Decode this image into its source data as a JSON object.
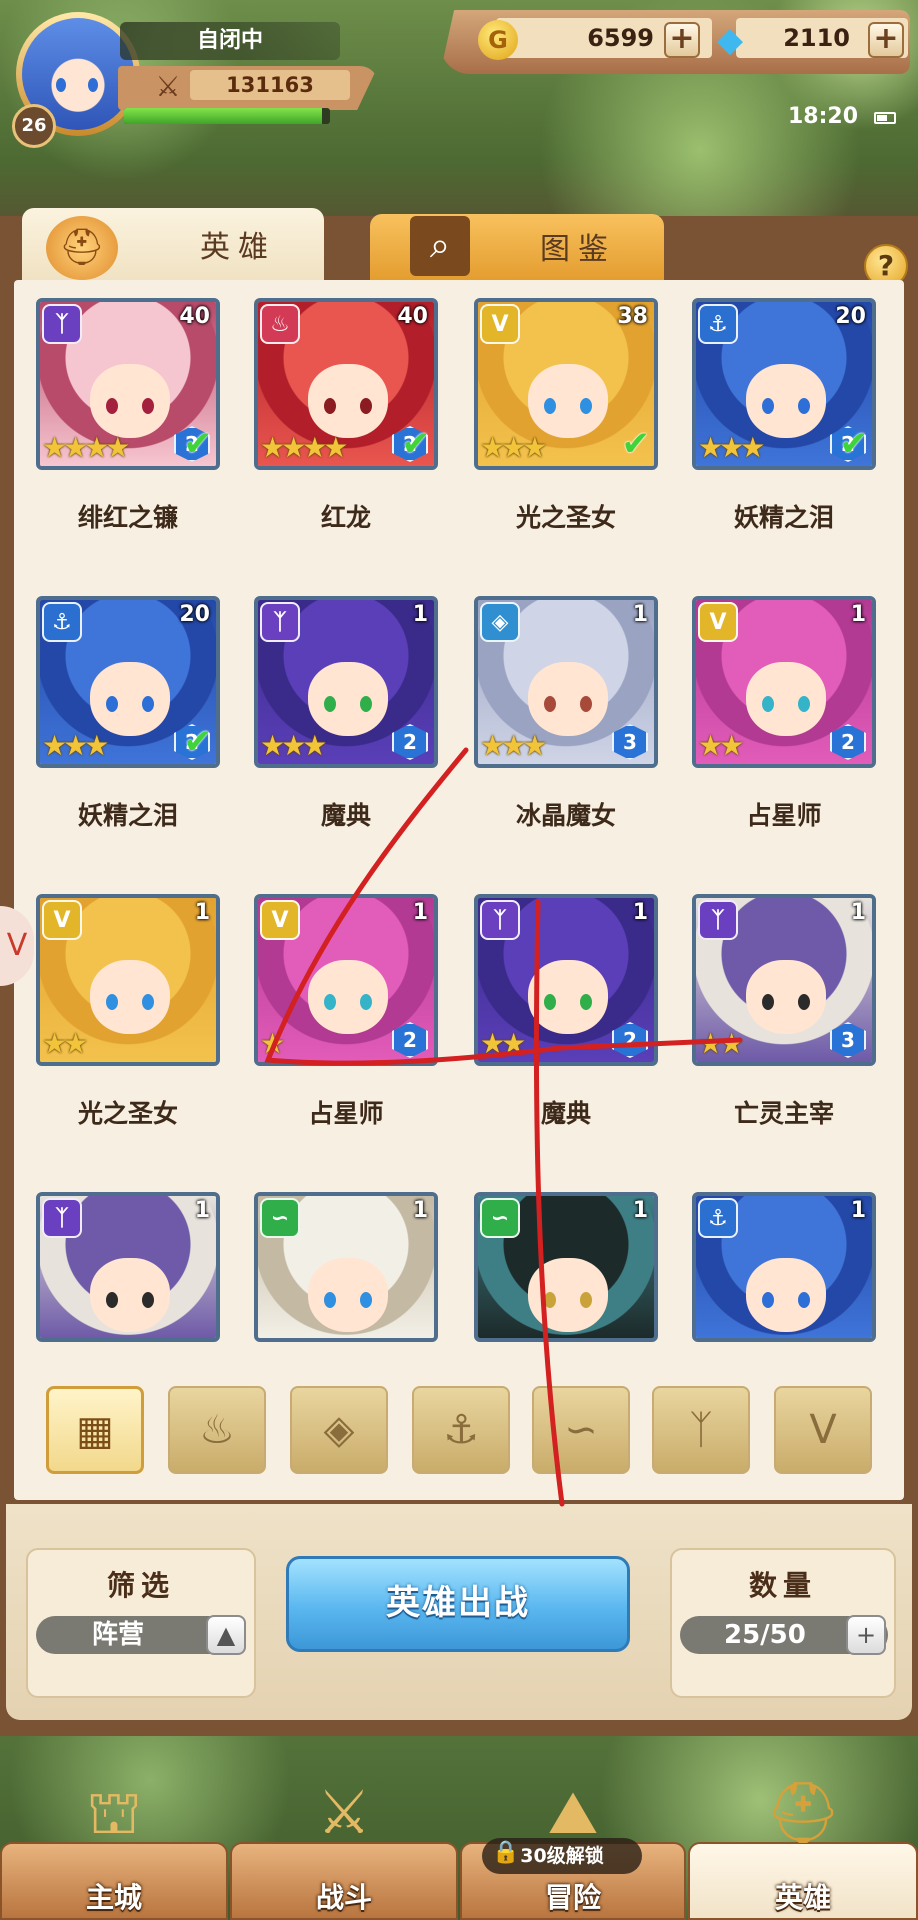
{
  "player": {
    "name": "自闭中",
    "level": "26",
    "power": "131163",
    "exp_fraction": 0.96
  },
  "resources": {
    "gold": "6599",
    "diamonds": "2110"
  },
  "status": {
    "time": "18:20"
  },
  "tabs": [
    {
      "label": "英雄",
      "icon": "helmet-icon",
      "active": true
    },
    {
      "label": "图鉴",
      "icon": "magnifier-icon",
      "active": false
    }
  ],
  "help_label": "?",
  "factions": {
    "shadow": {
      "glyph": "ᛉ",
      "color": "#6a3fc0"
    },
    "flame": {
      "glyph": "♨",
      "color": "#d23a55"
    },
    "light": {
      "glyph": "V",
      "color": "#e3b62a"
    },
    "ocean": {
      "glyph": "⚓",
      "color": "#2b6fd0"
    },
    "crystal": {
      "glyph": "◈",
      "color": "#2f8fd0"
    },
    "beast": {
      "glyph": "∽",
      "color": "#2fae4a"
    }
  },
  "heroes": [
    {
      "name": "绯红之镰",
      "faction": "shadow",
      "level": "40",
      "stars": "★★★★",
      "rank": "2",
      "checked": true
    },
    {
      "name": "红龙",
      "faction": "flame",
      "level": "40",
      "stars": "★★★★",
      "rank": "2",
      "checked": true
    },
    {
      "name": "光之圣女",
      "faction": "light",
      "level": "38",
      "stars": "★★★",
      "rank": "",
      "checked": true
    },
    {
      "name": "妖精之泪",
      "faction": "ocean",
      "level": "20",
      "stars": "★★★",
      "rank": "2",
      "checked": true
    },
    {
      "name": "妖精之泪",
      "faction": "ocean",
      "level": "20",
      "stars": "★★★",
      "rank": "2",
      "checked": true
    },
    {
      "name": "魔典",
      "faction": "shadow",
      "level": "1",
      "stars": "★★★",
      "rank": "2",
      "checked": false
    },
    {
      "name": "冰晶魔女",
      "faction": "crystal",
      "level": "1",
      "stars": "★★★",
      "rank": "3",
      "checked": false
    },
    {
      "name": "占星师",
      "faction": "light",
      "level": "1",
      "stars": "★★",
      "rank": "2",
      "checked": false
    },
    {
      "name": "光之圣女",
      "faction": "light",
      "level": "1",
      "stars": "★★",
      "rank": "",
      "checked": false
    },
    {
      "name": "占星师",
      "faction": "light",
      "level": "1",
      "stars": "★",
      "rank": "2",
      "checked": false
    },
    {
      "name": "魔典",
      "faction": "shadow",
      "level": "1",
      "stars": "★★",
      "rank": "2",
      "checked": false
    },
    {
      "name": "亡灵主宰",
      "faction": "shadow",
      "level": "1",
      "stars": "★★",
      "rank": "3",
      "checked": false
    },
    {
      "name": "",
      "faction": "shadow",
      "level": "1",
      "stars": "",
      "rank": "",
      "checked": false
    },
    {
      "name": "",
      "faction": "beast",
      "level": "1",
      "stars": "",
      "rank": "",
      "checked": false
    },
    {
      "name": "",
      "faction": "beast",
      "level": "1",
      "stars": "",
      "rank": "",
      "checked": false
    },
    {
      "name": "",
      "faction": "ocean",
      "level": "1",
      "stars": "",
      "rank": "",
      "checked": false
    }
  ],
  "filters": [
    {
      "name": "all",
      "icon": "grid-icon",
      "glyph": "▦",
      "active": true
    },
    {
      "name": "flame",
      "icon": "flame-faction-icon",
      "glyph": "♨",
      "active": false
    },
    {
      "name": "crystal",
      "icon": "crystal-faction-icon",
      "glyph": "◈",
      "active": false
    },
    {
      "name": "ocean",
      "icon": "anchor-icon",
      "glyph": "⚓",
      "active": false
    },
    {
      "name": "beast",
      "icon": "beast-faction-icon",
      "glyph": "∽",
      "active": false
    },
    {
      "name": "shadow",
      "icon": "shadow-faction-icon",
      "glyph": "ᛉ",
      "active": false
    },
    {
      "name": "light",
      "icon": "light-faction-icon",
      "glyph": "V",
      "active": false
    }
  ],
  "filter_box": {
    "title": "筛选",
    "value": "阵营",
    "arrow": "▲"
  },
  "deploy_button": "英雄出战",
  "count_box": {
    "title": "数量",
    "value": "25/50",
    "plus": "+"
  },
  "nav": [
    {
      "label": "主城",
      "icon": "castle-icon",
      "active": false
    },
    {
      "label": "战斗",
      "icon": "crossed-swords-icon",
      "active": false
    },
    {
      "label": "冒险",
      "icon": "adventure-icon",
      "active": false,
      "lock": "30级解锁"
    },
    {
      "label": "英雄",
      "icon": "hero-helmet-icon",
      "active": true
    }
  ]
}
